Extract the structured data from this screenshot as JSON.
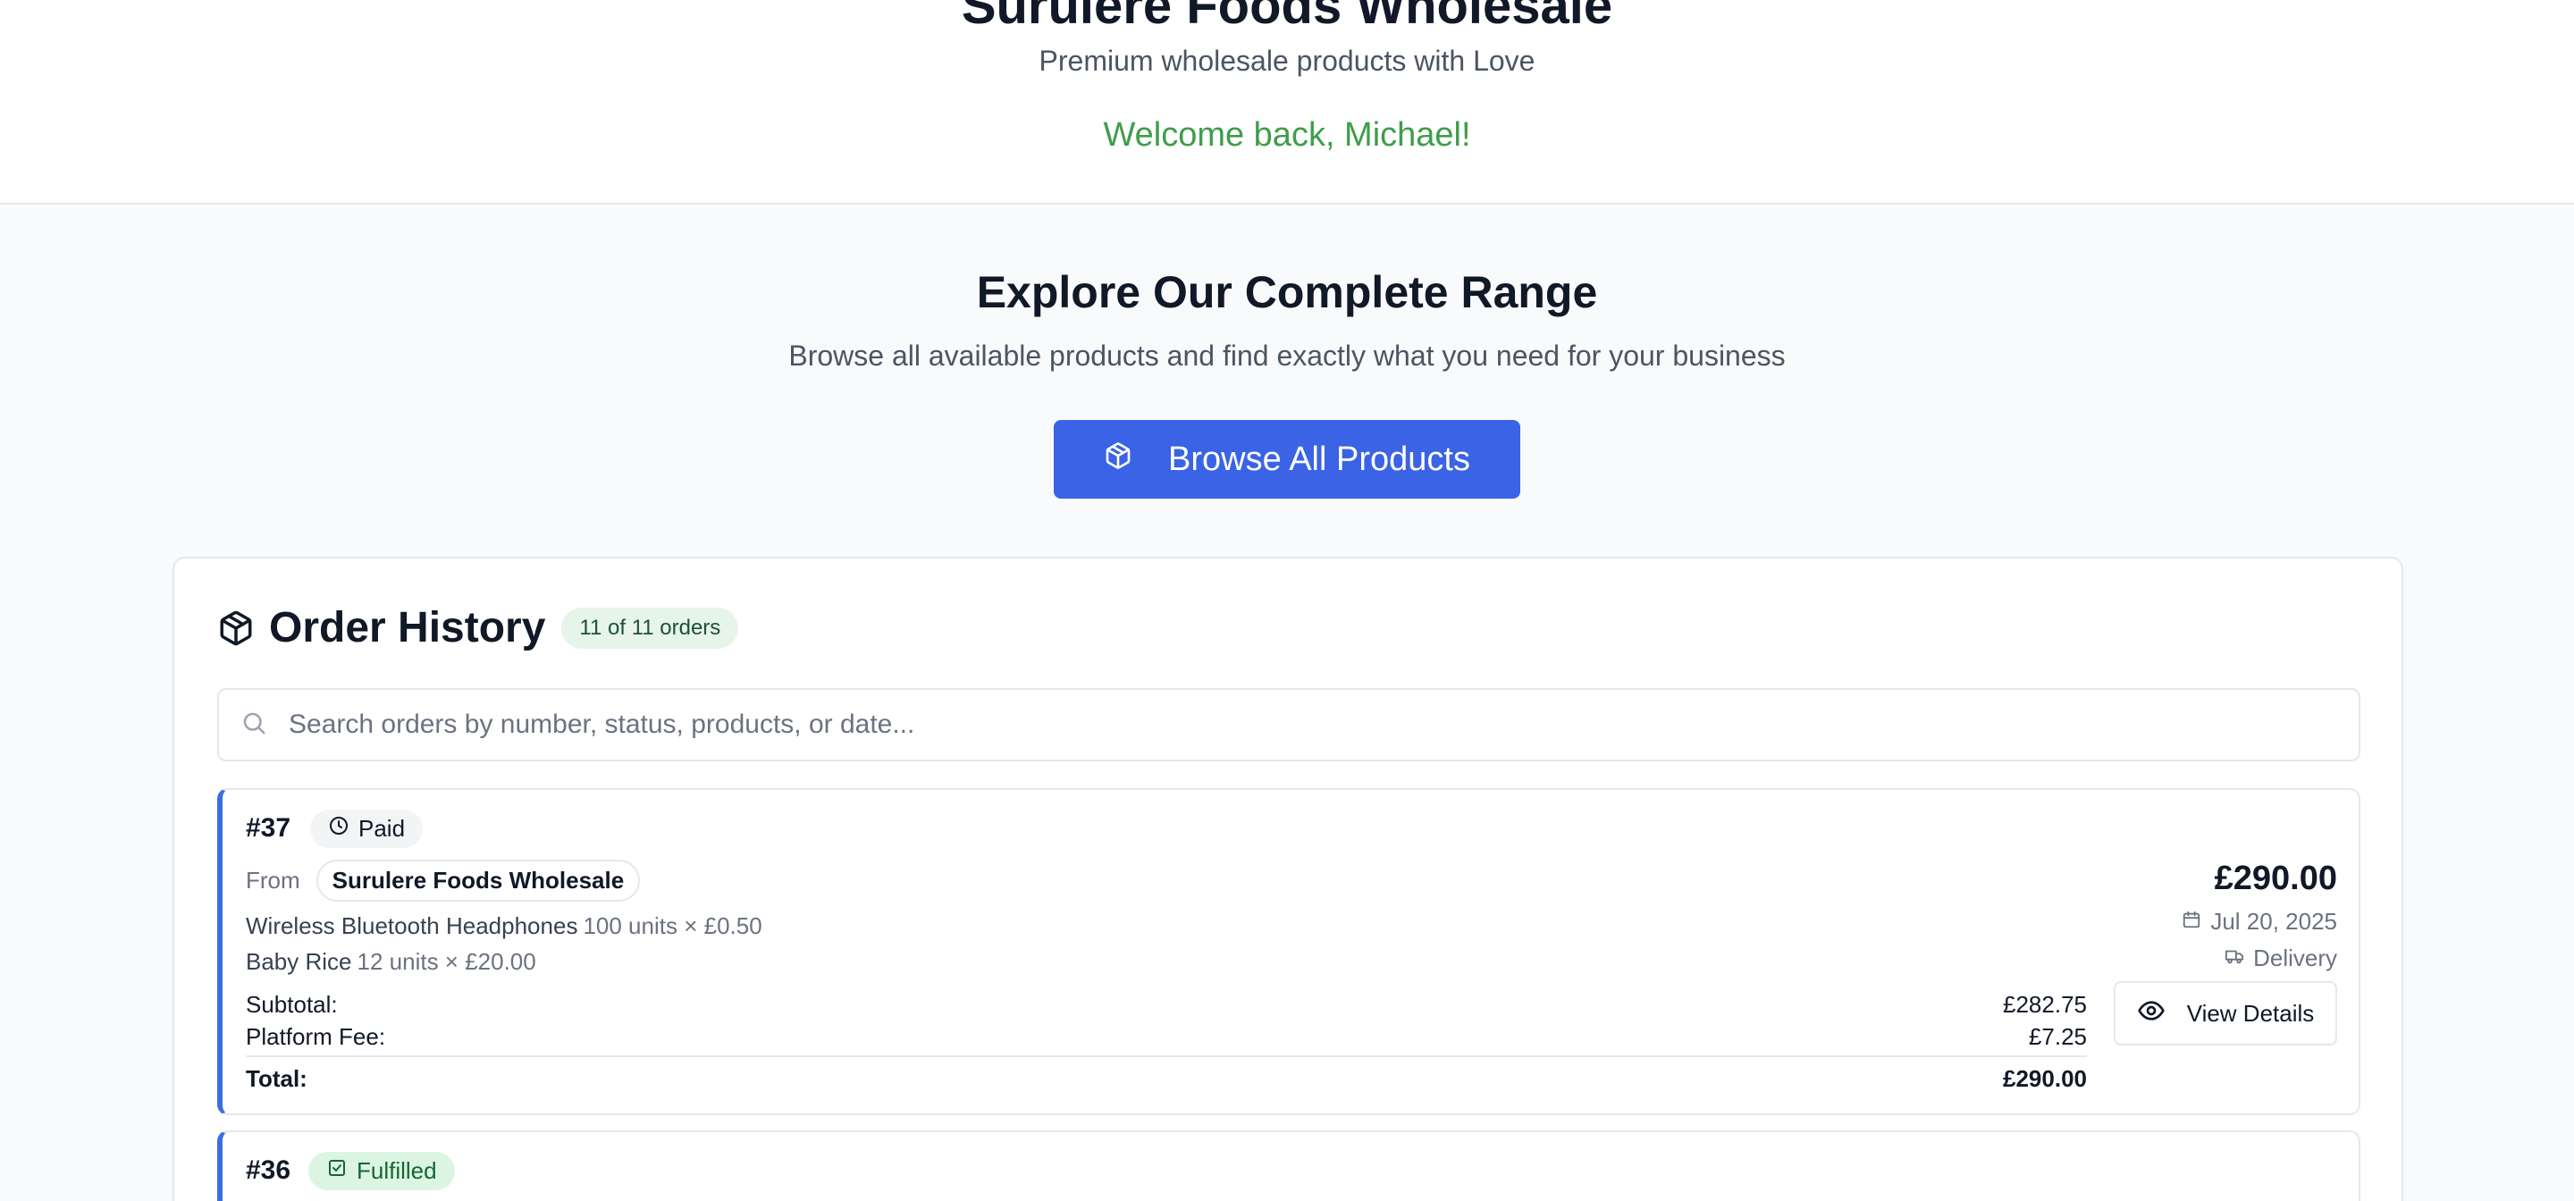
{
  "header": {
    "store_name": "Surulere Foods Wholesale",
    "tagline": "Premium wholesale products with Love",
    "welcome": "Welcome back, Michael!"
  },
  "explore": {
    "title": "Explore Our Complete Range",
    "subtitle": "Browse all available products and find exactly what you need for your business",
    "button_label": "Browse All Products",
    "button_icon": "box-icon"
  },
  "order_history": {
    "title": "Order History",
    "count_badge": "11 of 11 orders",
    "search_placeholder": "Search orders by number, status, products, or date...",
    "orders": [
      {
        "number": "#37",
        "status": "Paid",
        "status_icon": "clock-icon",
        "from_label": "From",
        "vendor": "Surulere Foods Wholesale",
        "items": [
          {
            "name": "Wireless Bluetooth Headphones",
            "qty": "100 units × £0.50"
          },
          {
            "name": "Baby Rice",
            "qty": "12 units × £20.00"
          }
        ],
        "subtotal_label": "Subtotal:",
        "subtotal": "£282.75",
        "fee_label": "Platform Fee:",
        "fee": "£7.25",
        "total_label": "Total:",
        "total": "£290.00",
        "amount": "£290.00",
        "date": "Jul 20, 2025",
        "delivery": "Delivery",
        "view_label": "View Details"
      },
      {
        "number": "#36",
        "status": "Fulfilled",
        "status_icon": "package-check-icon"
      }
    ]
  },
  "colors": {
    "primary": "#3a63e6",
    "accent_border": "#3b6fe0",
    "welcome_green": "#3f9d4a",
    "badge_bg": "#e6f4ea",
    "fulfilled_bg": "#dcf5e3"
  }
}
